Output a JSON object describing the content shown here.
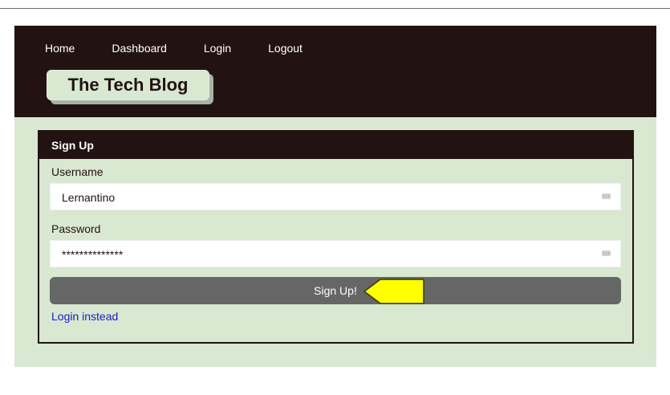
{
  "nav": {
    "items": [
      "Home",
      "Dashboard",
      "Login",
      "Logout"
    ]
  },
  "brand": {
    "title": "The Tech Blog"
  },
  "signup_card": {
    "header": "Sign Up",
    "username": {
      "label": "Username",
      "value": "Lernantino",
      "icon": "password-manager-key-icon"
    },
    "password": {
      "label": "Password",
      "value": "**************",
      "icon": "password-manager-key-icon"
    },
    "submit_label": "Sign Up!",
    "login_link": "Login instead"
  },
  "annotation": {
    "icon": "yellow-pointer-arrow-icon",
    "color": "#ffff00"
  },
  "colors": {
    "dark": "#231212",
    "background": "#d8e8d1",
    "button": "#666666",
    "link": "#1a1acc"
  }
}
